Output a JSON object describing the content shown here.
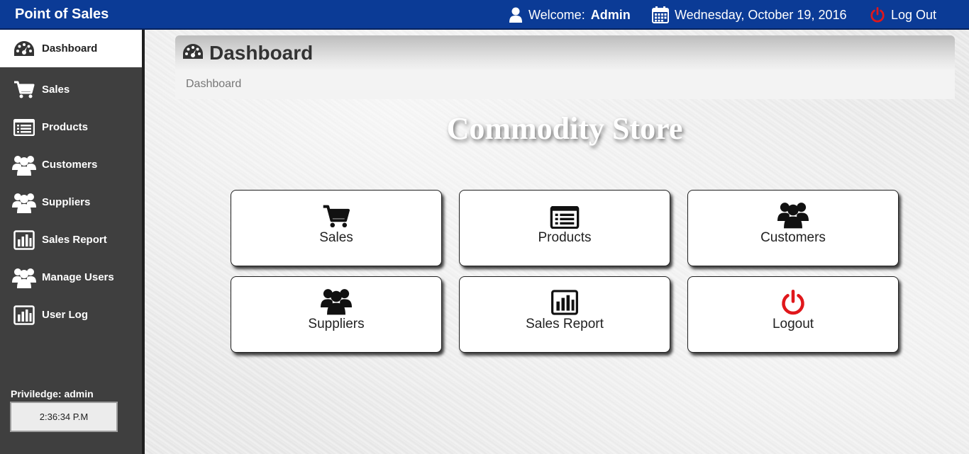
{
  "app": {
    "title": "Point of Sales"
  },
  "header": {
    "welcome_label": "Welcome:",
    "user": "Admin",
    "date": "Wednesday, October 19, 2016",
    "logout_label": "Log Out"
  },
  "sidebar": {
    "items": [
      {
        "label": "Dashboard",
        "icon": "dashboard-icon",
        "active": true
      },
      {
        "label": "Sales",
        "icon": "cart-icon"
      },
      {
        "label": "Products",
        "icon": "list-icon"
      },
      {
        "label": "Customers",
        "icon": "users-icon"
      },
      {
        "label": "Suppliers",
        "icon": "users-icon"
      },
      {
        "label": "Sales Report",
        "icon": "bar-chart-icon"
      },
      {
        "label": "Manage Users",
        "icon": "users-icon"
      },
      {
        "label": "User Log",
        "icon": "bar-chart-icon"
      }
    ],
    "privilege": "Priviledge: admin",
    "clock": "2:36:34 P.M"
  },
  "main": {
    "panel_title": "Dashboard",
    "breadcrumb": "Dashboard",
    "store_name": "Commodity Store",
    "tiles": [
      {
        "label": "Sales",
        "icon": "cart-icon"
      },
      {
        "label": "Products",
        "icon": "list-icon"
      },
      {
        "label": "Customers",
        "icon": "users-icon"
      },
      {
        "label": "Suppliers",
        "icon": "users-icon"
      },
      {
        "label": "Sales Report",
        "icon": "bar-chart-icon"
      },
      {
        "label": "Logout",
        "icon": "power-icon"
      }
    ]
  },
  "colors": {
    "topbar": "#0b3b96",
    "sidebar": "#3f3f3f",
    "logout_red": "#e0171b"
  }
}
